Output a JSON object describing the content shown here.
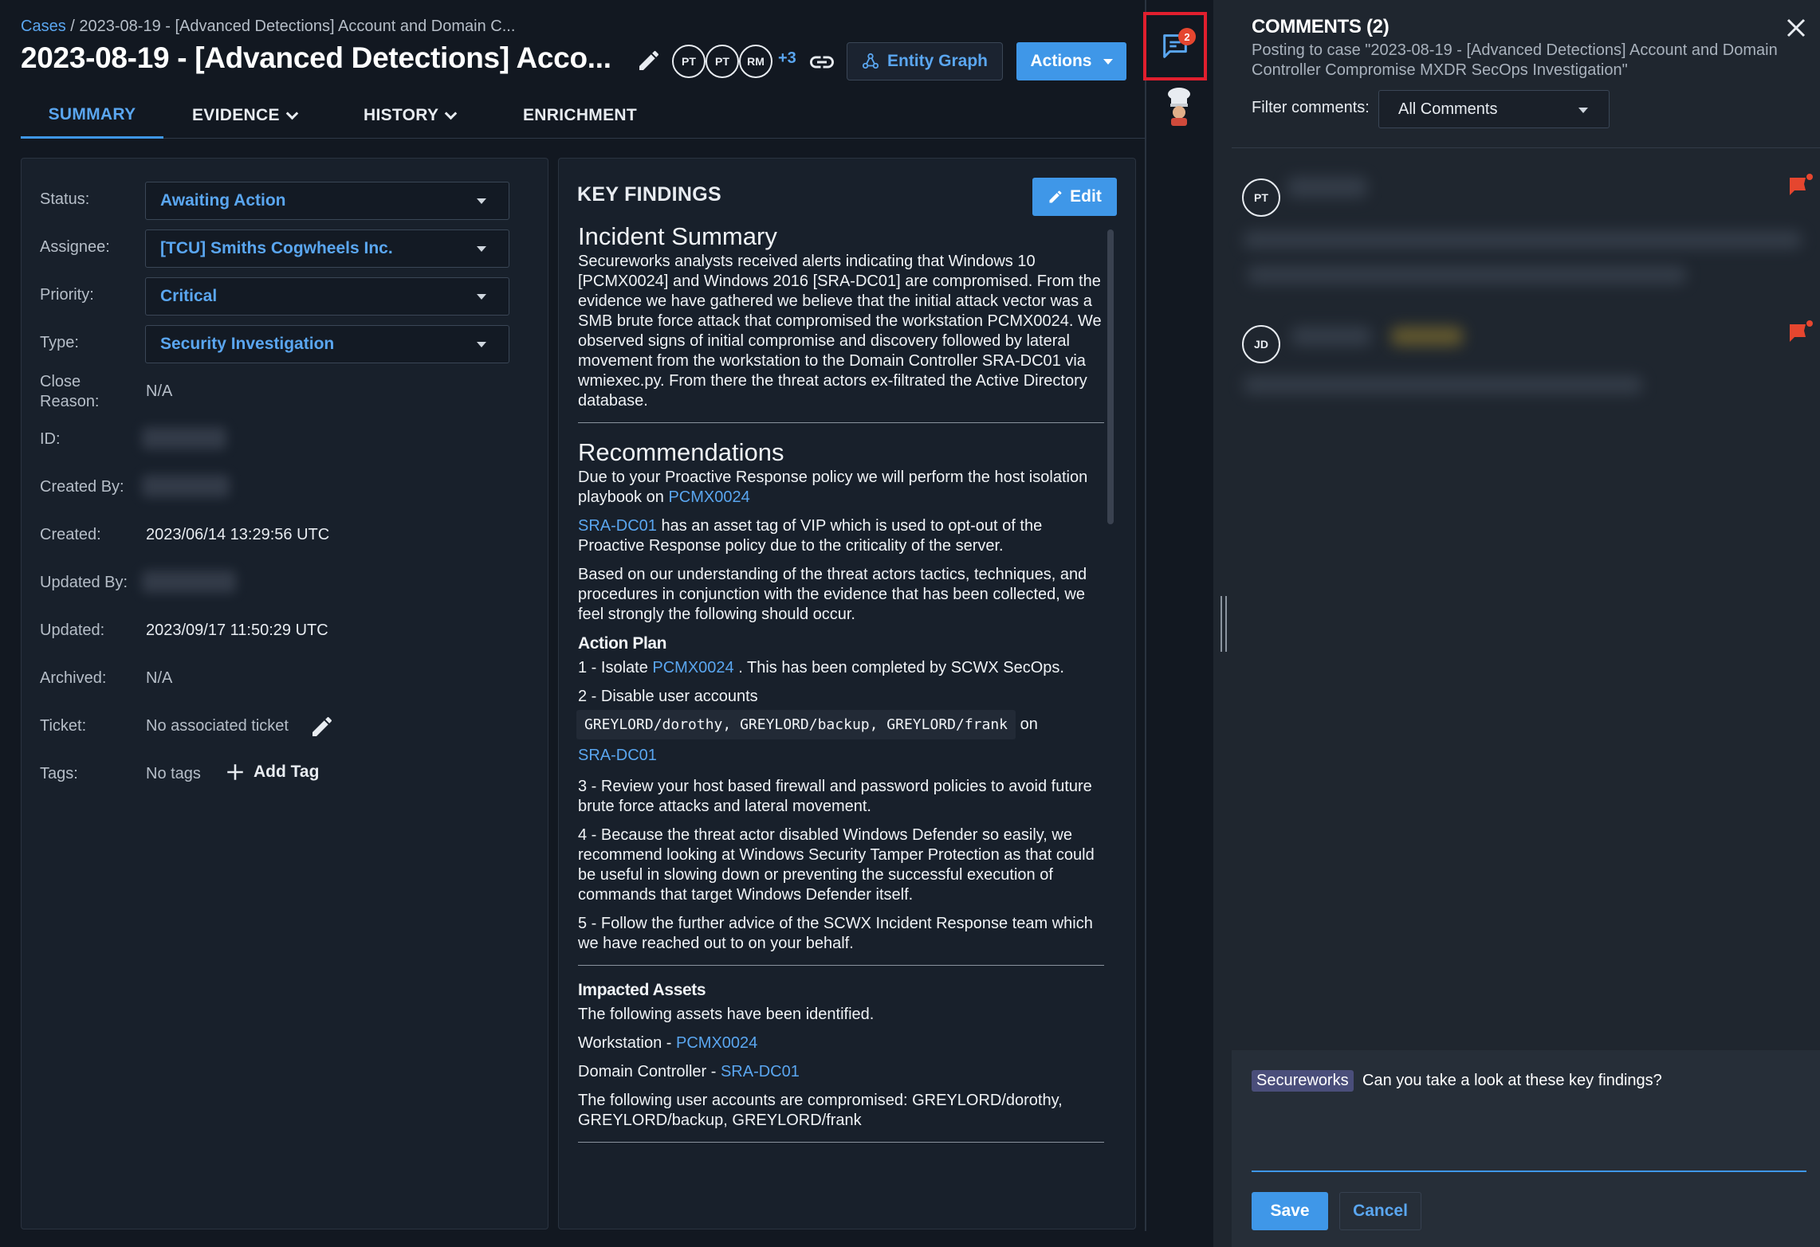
{
  "breadcrumb": {
    "root": "Cases",
    "separator": "/",
    "current": "2023-08-19 - [Advanced Detections] Account and Domain C..."
  },
  "header": {
    "title": "2023-08-19 - [Advanced Detections] Acco...",
    "watchers": [
      "PT",
      "PT",
      "RM"
    ],
    "watchers_more": "+3",
    "entity_graph_label": "Entity Graph",
    "actions_label": "Actions"
  },
  "tabs": [
    {
      "label": "SUMMARY"
    },
    {
      "label": "EVIDENCE"
    },
    {
      "label": "HISTORY"
    },
    {
      "label": "ENRICHMENT"
    }
  ],
  "rail": {
    "comment_count": "2"
  },
  "details": {
    "status_label": "Status:",
    "status_value": "Awaiting Action",
    "assignee_label": "Assignee:",
    "assignee_value": "[TCU] Smiths Cogwheels Inc.",
    "priority_label": "Priority:",
    "priority_value": "Critical",
    "type_label": "Type:",
    "type_value": "Security Investigation",
    "close_reason_label_1": "Close",
    "close_reason_label_2": "Reason:",
    "close_reason_value": "N/A",
    "id_label": "ID:",
    "created_by_label": "Created By:",
    "created_label": "Created:",
    "created_value": "2023/06/14 13:29:56 UTC",
    "updated_by_label": "Updated By:",
    "updated_label": "Updated:",
    "updated_value": "2023/09/17 11:50:29 UTC",
    "archived_label": "Archived:",
    "archived_value": "N/A",
    "ticket_label": "Ticket:",
    "ticket_value": "No associated ticket",
    "tags_label": "Tags:",
    "tags_value": "No tags",
    "add_tag_label": "Add Tag"
  },
  "key_findings": {
    "heading": "KEY FINDINGS",
    "edit_label": "Edit",
    "incident_summary_title": "Incident Summary",
    "incident_summary_text": "Secureworks analysts received alerts indicating that Windows 10 [PCMX0024] and Windows 2016 [SRA-DC01] are compromised. From the evidence we have gathered we believe that the initial attack vector was a SMB brute force attack that compromised the workstation PCMX0024. We observed signs of initial compromise and discovery followed by lateral movement from the workstation to the Domain Controller SRA-DC01 via wmiexec.py. From there the threat actors ex-filtrated the Active Directory database.",
    "recommendations_title": "Recommendations",
    "rec_p1_text": "Due to your Proactive Response policy we will perform the host isolation playbook on",
    "rec_p1_link": "PCMX0024",
    "rec_p2_link": "SRA-DC01",
    "rec_p2_text": "has an asset tag of VIP which is used to opt-out of the Proactive Response policy due to the criticality of the server.",
    "rec_p3_text": "Based on our understanding of the threat actors tactics, techniques, and procedures in conjunction with the evidence that has been collected, we feel strongly the following should occur.",
    "action_plan_title": "Action Plan",
    "ap1_prefix": "1 - Isolate",
    "ap1_link": "PCMX0024",
    "ap1_suffix": ". This has been completed by SCWX SecOps.",
    "ap2_text": "2 - Disable user accounts",
    "ap2_code": "GREYLORD/dorothy, GREYLORD/backup, GREYLORD/frank",
    "ap2_on": "on",
    "ap2_link": "SRA-DC01",
    "ap3_text": "3 - Review your host based firewall and password policies to avoid future brute force attacks and lateral movement.",
    "ap4_text": "4 - Because the threat actor disabled Windows Defender so easily, we recommend looking at Windows Security Tamper Protection as that could be useful in slowing down or preventing the successful execution of commands that target Windows Defender itself.",
    "ap5_text": "5 - Follow the further advice of the SCWX Incident Response team which we have reached out to on your behalf.",
    "impacted_title": "Impacted Assets",
    "impacted_intro": "The following assets have been identified.",
    "workstation_prefix": "Workstation -",
    "workstation_link": "PCMX0024",
    "dc_prefix": "Domain Controller -",
    "dc_link": "SRA-DC01",
    "accounts_text": "The following user accounts are compromised: GREYLORD/dorothy, GREYLORD/backup, GREYLORD/frank"
  },
  "comments": {
    "title": "COMMENTS (2)",
    "posting_to": "Posting to case \"2023-08-19 - [Advanced Detections] Account and Domain Controller Compromise MXDR SecOps Investigation\"",
    "filter_label": "Filter comments:",
    "filter_value": "All Comments",
    "items": [
      {
        "initials": "PT"
      },
      {
        "initials": "JD"
      }
    ],
    "draft_mention": "Secureworks",
    "draft_text": "Can you take a look at these key findings?",
    "save_label": "Save",
    "cancel_label": "Cancel"
  },
  "colors": {
    "accent": "#3f97e8",
    "link": "#5aa6f0",
    "alert": "#e5462f",
    "highlight_border": "#e11f2e"
  }
}
